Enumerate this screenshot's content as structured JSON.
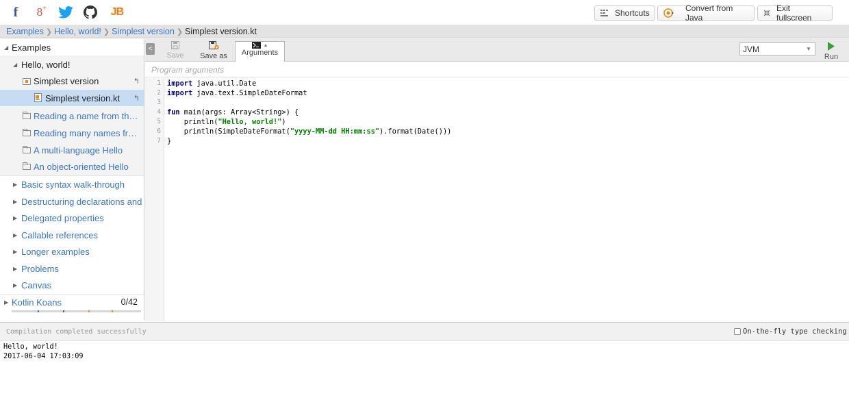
{
  "top_bar": {
    "jb_label": "JB",
    "buttons": {
      "shortcuts": "Shortcuts",
      "convert": "Convert from Java",
      "exit": "Exit fullscreen"
    }
  },
  "breadcrumb": [
    "Examples",
    "Hello, world!",
    "Simplest version",
    "Simplest version.kt"
  ],
  "sidebar": {
    "root": "Examples",
    "group": "Hello, world!",
    "active_folder": "Simplest version",
    "active_file": "Simplest version.kt",
    "hello_items": [
      "Reading a name from the command line",
      "Reading many names from the command line",
      "A multi-language Hello",
      "An object-oriented Hello"
    ],
    "sections": [
      "Basic syntax walk-through",
      "Destructuring declarations and Data classes",
      "Delegated properties",
      "Callable references",
      "Longer examples",
      "Problems",
      "Canvas"
    ],
    "koans": {
      "label": "Kotlin Koans",
      "progress": "0/42"
    }
  },
  "toolbar": {
    "save": "Save",
    "save_as": "Save as",
    "arguments": "Arguments",
    "target": "JVM",
    "run": "Run"
  },
  "program_arguments_placeholder": "Program arguments",
  "code_lines": [
    "import java.util.Date",
    "import java.text.SimpleDateFormat",
    "",
    "fun main(args: Array<String>) {",
    "    println(\"Hello, world!\")",
    "    println(SimpleDateFormat(\"yyyy-MM-dd HH:mm:ss\").format(Date()))",
    "}"
  ],
  "console": {
    "status": "Compilation completed successfully",
    "fly_checking": "On-the-fly type checking",
    "output": [
      "Hello, world!",
      "2017-06-04 17:03:09"
    ]
  },
  "colors": {
    "link": "#3a76c4",
    "selection": "#c6dcf3",
    "run_green": "#3c9c3c",
    "keyword": "#000080",
    "string": "#008000"
  }
}
